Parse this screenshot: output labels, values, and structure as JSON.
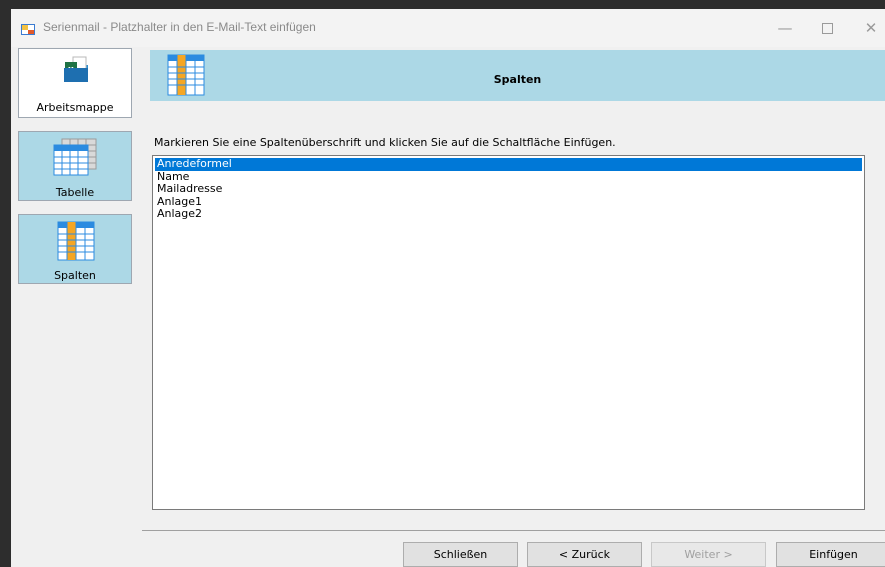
{
  "window": {
    "title": "Serienmail - Platzhalter in den E-Mail-Text einfügen",
    "controls": {
      "minimize": "—",
      "maximize": "",
      "close": "✕"
    }
  },
  "nav": {
    "items": [
      {
        "label": "Arbeitsmappe",
        "icon": "excel-workbook-icon"
      },
      {
        "label": "Tabelle",
        "icon": "table-icon"
      },
      {
        "label": "Spalten",
        "icon": "columns-icon"
      }
    ]
  },
  "header": {
    "title": "Spalten",
    "icon": "columns-icon"
  },
  "instruction": "Markieren Sie eine Spaltenüberschrift und klicken Sie auf die Schaltfläche Einfügen.",
  "columns_list": {
    "items": [
      "Anredeformel",
      "Name",
      "Mailadresse",
      "Anlage1",
      "Anlage2"
    ],
    "selected": "Anredeformel"
  },
  "buttons": {
    "close": "Schließen",
    "back": "< Zurück",
    "next": "Weiter >",
    "insert": "Einfügen"
  },
  "colors": {
    "accent_panel": "#acd8e6",
    "selection": "#0078d7",
    "column_highlight": "#f5a623",
    "excel_green": "#1f7244"
  }
}
